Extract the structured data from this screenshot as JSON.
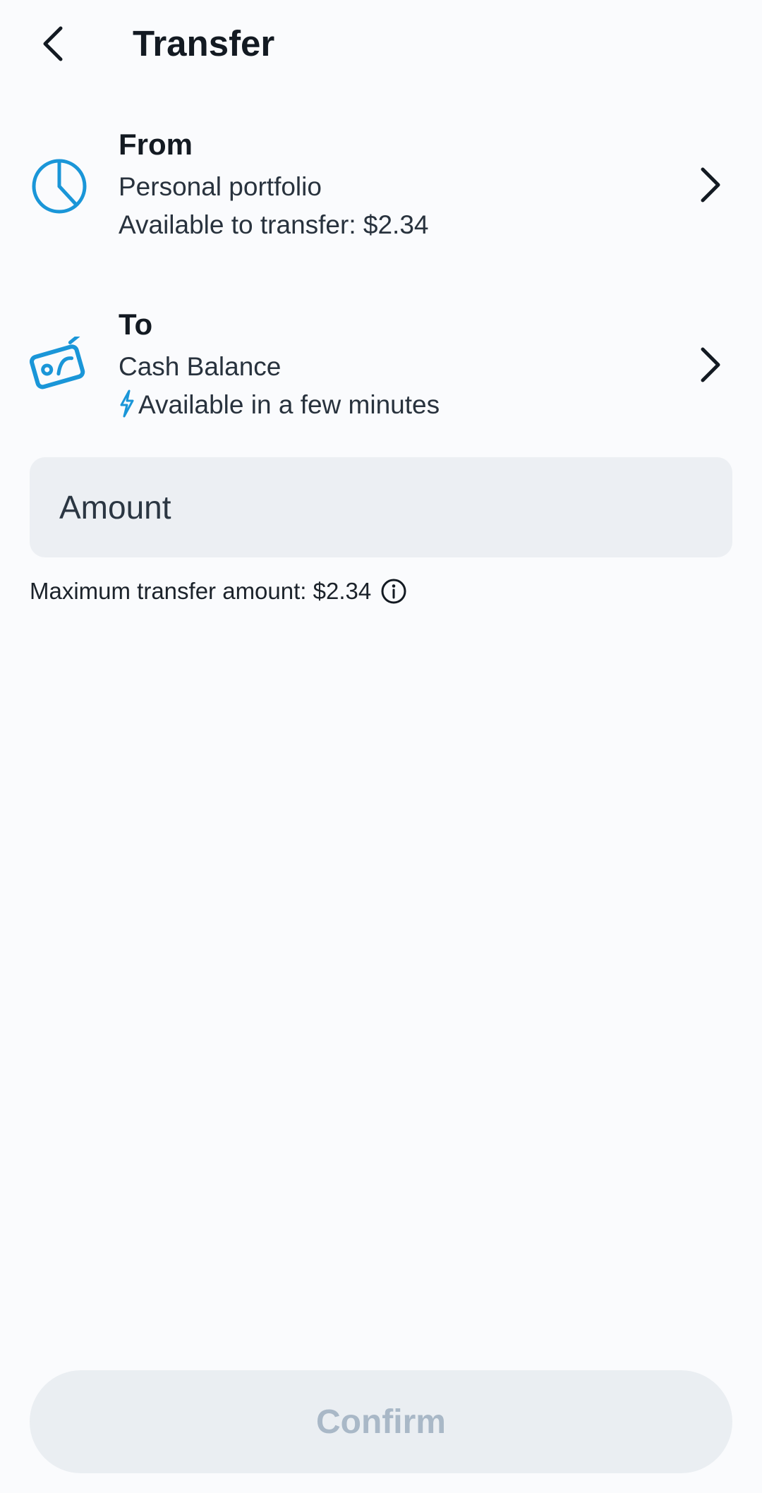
{
  "header": {
    "title": "Transfer"
  },
  "from": {
    "heading": "From",
    "account": "Personal portfolio",
    "detail": "Available to transfer: $2.34",
    "icon": "pie-chart-icon"
  },
  "to": {
    "heading": "To",
    "account": "Cash Balance",
    "detail": "Available in a few minutes",
    "icon": "cash-wallet-icon"
  },
  "amount": {
    "placeholder": "Amount",
    "value": ""
  },
  "max_note": {
    "text": "Maximum transfer amount: $2.34"
  },
  "confirm": {
    "label": "Confirm",
    "enabled": false
  },
  "colors": {
    "accent": "#1a96d8",
    "background": "#fafbfd",
    "field_bg": "#eceff3",
    "disabled_text": "#a9b8c7"
  }
}
